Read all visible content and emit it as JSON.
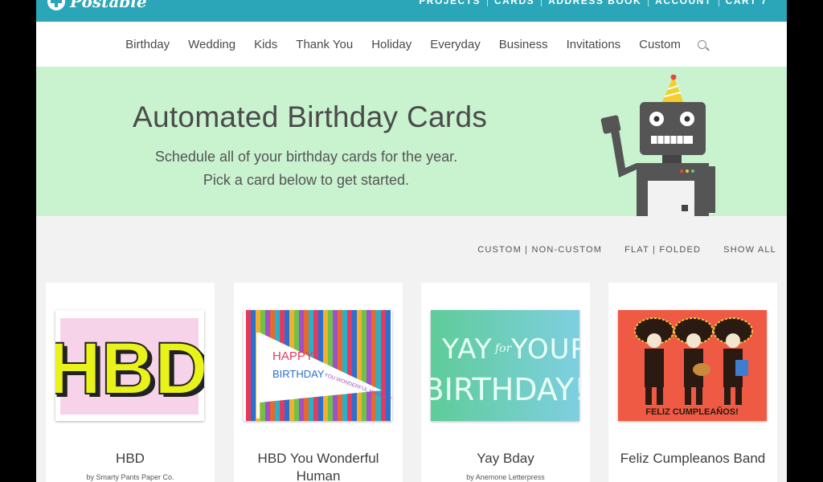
{
  "brand": {
    "name": "Postable"
  },
  "topnav": [
    "PROJECTS",
    "CARDS",
    "ADDRESS BOOK",
    "ACCOUNT",
    "CART 7"
  ],
  "categories": [
    "Birthday",
    "Wedding",
    "Kids",
    "Thank You",
    "Holiday",
    "Everyday",
    "Business",
    "Invitations",
    "Custom"
  ],
  "hero": {
    "title": "Automated Birthday Cards",
    "line1": "Schedule all of your birthday cards for the year.",
    "line2": "Pick a card below to get started."
  },
  "filters": {
    "custom": "CUSTOM | NON-CUSTOM",
    "flat": "FLAT | FOLDED",
    "all": "SHOW ALL"
  },
  "cards": [
    {
      "title": "HBD",
      "by": "by Smarty Pants Paper Co.",
      "art_text": "HBD"
    },
    {
      "title": "HBD You Wonderful Human",
      "by": "",
      "art_line1": "HAPPY",
      "art_line2": "BIRTHDAY",
      "art_side": "YOU WONDERFUL HUMAN YOU"
    },
    {
      "title": "Yay Bday",
      "by": "by Anemone Letterpress",
      "art_line1": "YAY",
      "art_mid": "for",
      "art_line1b": "YOUR",
      "art_line2": "BIRTHDAY!"
    },
    {
      "title": "Feliz Cumpleanos Band",
      "by": "",
      "art_caption": "FELIZ CUMPLEAÑOS!"
    }
  ],
  "colors": {
    "teal": "#2aa6b8",
    "mint": "#c9f2cf",
    "hbd_yellow": "#e9f219",
    "hbd_pink": "#f6d3e8",
    "yay_green": "#6fcfa8",
    "band_red": "#ee5a43"
  },
  "icons": {
    "search": "search-icon",
    "logo": "postable-logo-icon",
    "robot": "robot-illustration"
  }
}
